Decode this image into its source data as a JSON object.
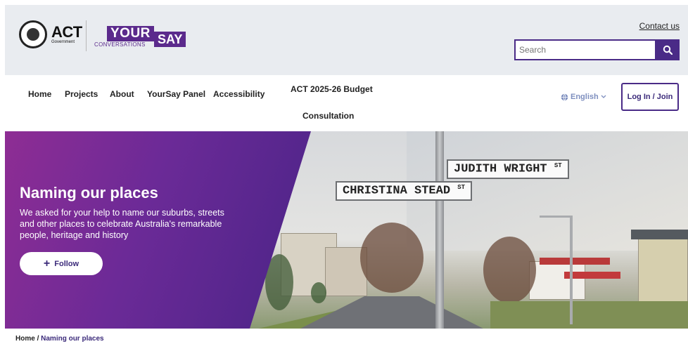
{
  "header": {
    "act_logo_text": "ACT",
    "act_logo_sub": "Government",
    "yoursay_your": "YOUR",
    "yoursay_say": "SAY",
    "yoursay_conversations": "CONVERSATIONS",
    "contact_label": "Contact us",
    "search_placeholder": "Search",
    "search_icon": "search-icon"
  },
  "nav": {
    "items": [
      "Home",
      "Projects",
      "About",
      "YourSay Panel",
      "Accessibility"
    ],
    "budget_line1": "ACT 2025-26 Budget",
    "budget_line2": "Consultation",
    "language": "English",
    "login": "Log In / Join"
  },
  "hero": {
    "title": "Naming our places",
    "description": "We asked for your help to name our suburbs, streets and other places to celebrate Australia's remarkable people, heritage and history",
    "follow_label": "Follow",
    "sign_1": "JUDITH WRIGHT",
    "sign_1_suffix": "ST",
    "sign_2": "CHRISTINA STEAD",
    "sign_2_suffix": "ST"
  },
  "breadcrumb": {
    "home": "Home",
    "separator": " / ",
    "current": "Naming our places"
  },
  "colors": {
    "brand_purple": "#4a2b87",
    "header_bg": "#e9ecf0",
    "hero_gradient_start": "#8e2d94",
    "hero_gradient_end": "#4a2487"
  }
}
